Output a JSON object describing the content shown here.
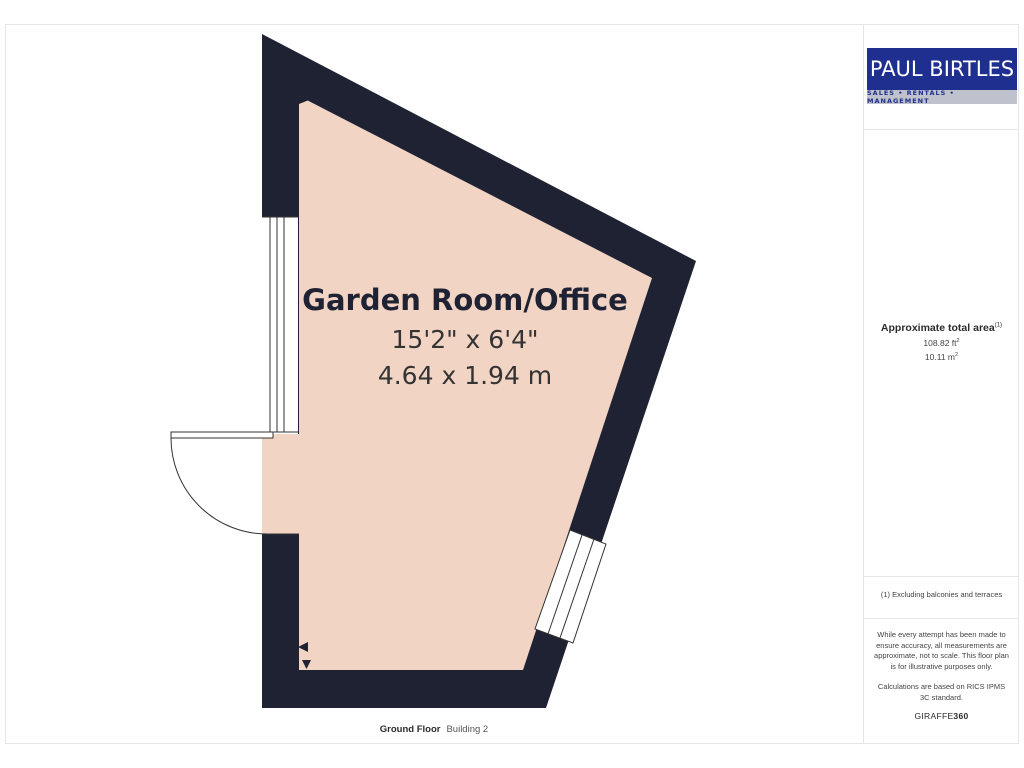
{
  "room": {
    "name": "Garden Room/Office",
    "dimensions_imperial": "15'2\" x 6'4\"",
    "dimensions_metric": "4.64 x 1.94 m"
  },
  "floor": {
    "name": "Ground Floor",
    "building": "Building 2"
  },
  "logo": {
    "name": "PAUL BIRTLES",
    "tagline": "SALES • RENTALS • MANAGEMENT"
  },
  "area": {
    "title": "Approximate total area",
    "title_marker": "(1)",
    "imperial_value": "108.82 ft",
    "metric_value": "10.11 m",
    "unit_superscript": "2"
  },
  "footnote": "(1) Excluding balconies and terraces",
  "disclaimer": {
    "p1": "While every attempt has been made to ensure accuracy, all measurements are approximate, not to scale. This floor plan is for illustrative purposes only.",
    "p2": "Calculations are based on RICS IPMS 3C standard."
  },
  "brand": {
    "part1": "GIRAFFE",
    "part2": "360"
  },
  "colors": {
    "wall": "#1f2233",
    "floor_fill": "#f2d4c5",
    "logo_blue": "#1f2f8f",
    "logo_grey": "#bfc2cc"
  }
}
